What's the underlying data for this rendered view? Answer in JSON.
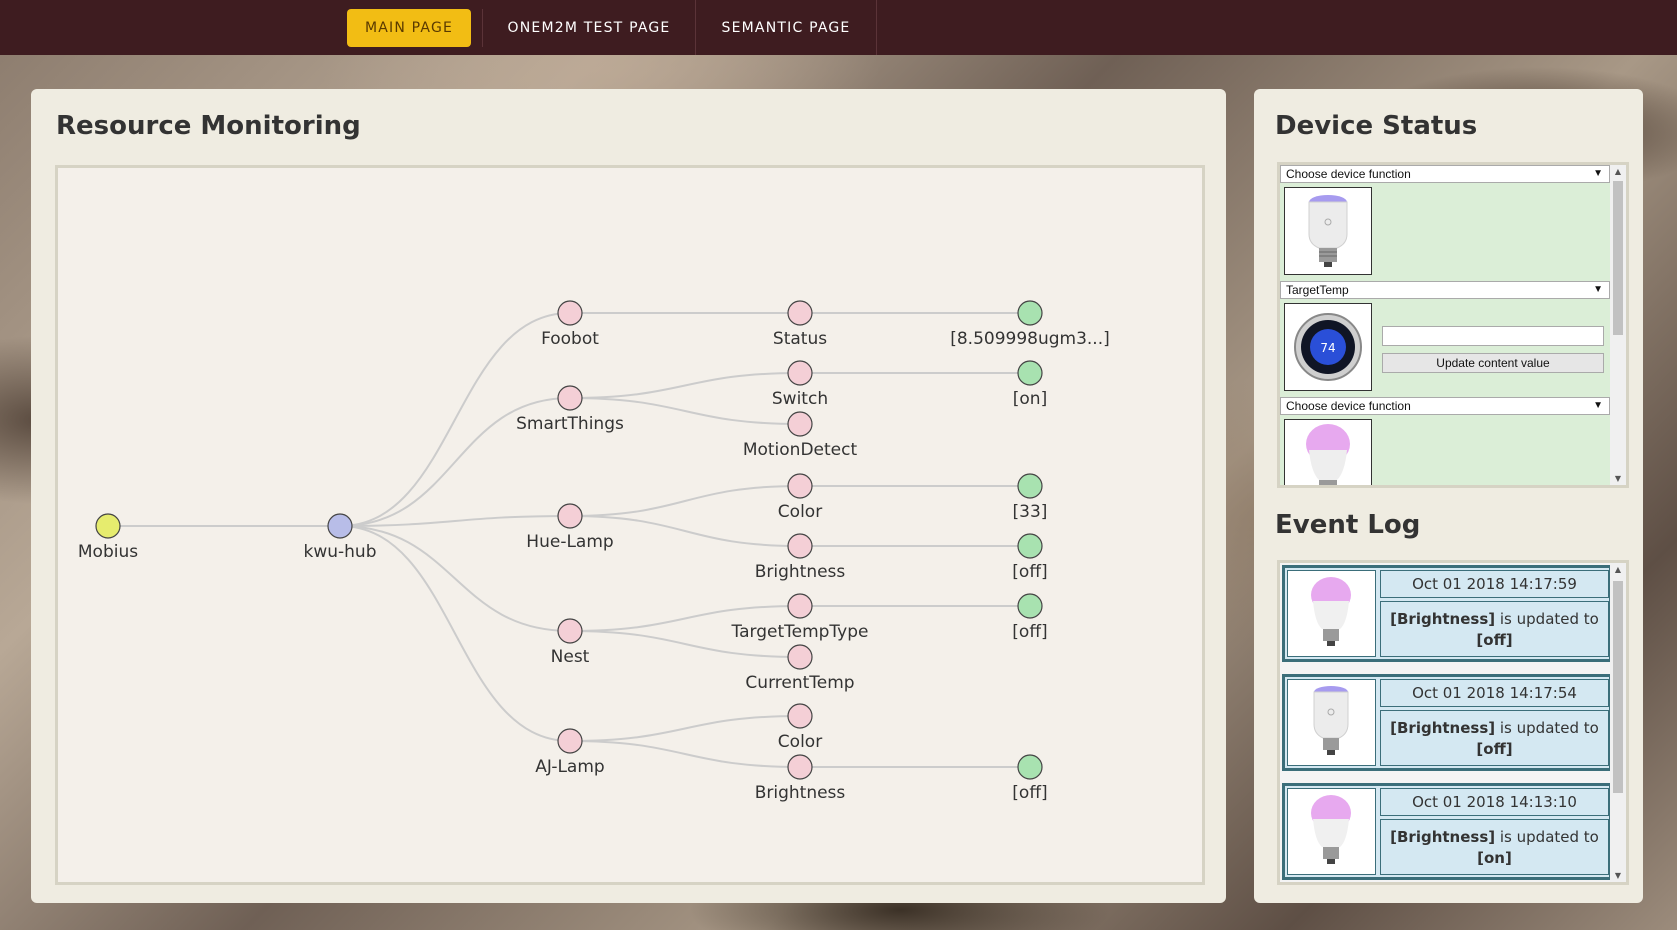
{
  "nav": {
    "items": [
      {
        "label": "MAIN PAGE",
        "active": true
      },
      {
        "label": "ONEM2M TEST PAGE",
        "active": false
      },
      {
        "label": "SEMANTIC PAGE",
        "active": false
      }
    ]
  },
  "monitoring": {
    "title": "Resource Monitoring",
    "tree": {
      "root": {
        "label": "Mobius",
        "color": "#e6ec6e"
      },
      "hub": {
        "label": "kwu-hub",
        "color": "#b8bde8"
      },
      "devices": [
        {
          "label": "Foobot",
          "resources": [
            {
              "label": "Status",
              "value": "[8.509998ugm3...]"
            }
          ]
        },
        {
          "label": "SmartThings",
          "resources": [
            {
              "label": "Switch",
              "value": "[on]"
            },
            {
              "label": "MotionDetect",
              "value": ""
            }
          ]
        },
        {
          "label": "Hue-Lamp",
          "resources": [
            {
              "label": "Color",
              "value": "[33]"
            },
            {
              "label": "Brightness",
              "value": "[off]"
            }
          ]
        },
        {
          "label": "Nest",
          "resources": [
            {
              "label": "TargetTempType",
              "value": "[off]"
            },
            {
              "label": "CurrentTemp",
              "value": ""
            }
          ]
        },
        {
          "label": "AJ-Lamp",
          "resources": [
            {
              "label": "Color",
              "value": ""
            },
            {
              "label": "Brightness",
              "value": "[off]"
            }
          ]
        }
      ],
      "colors": {
        "device": "#f4cfd6",
        "resource": "#f4cfd6",
        "value": "#a8e2b0",
        "link": "#cccccc"
      }
    }
  },
  "device_status": {
    "title": "Device Status",
    "rows": [
      {
        "select": "Choose device function",
        "image": "lamp-purple",
        "has_input": false
      },
      {
        "select": "TargetTemp",
        "image": "nest-thermostat",
        "thermostat_value": "74",
        "has_input": true,
        "input_value": "",
        "button": "Update content value"
      },
      {
        "select": "Choose device function",
        "image": "lamp-pink",
        "has_input": false
      }
    ]
  },
  "event_log": {
    "title": "Event Log",
    "entries": [
      {
        "time": "Oct 01 2018 14:17:59",
        "resource": "[Brightness]",
        "mid": " is updated to ",
        "value": "[off]",
        "image": "lamp-pink"
      },
      {
        "time": "Oct 01 2018 14:17:54",
        "resource": "[Brightness]",
        "mid": " is updated to ",
        "value": "[off]",
        "image": "lamp-purple"
      },
      {
        "time": "Oct 01 2018 14:13:10",
        "resource": "[Brightness]",
        "mid": " is updated to ",
        "value": "[on]",
        "image": "lamp-pink"
      }
    ]
  }
}
